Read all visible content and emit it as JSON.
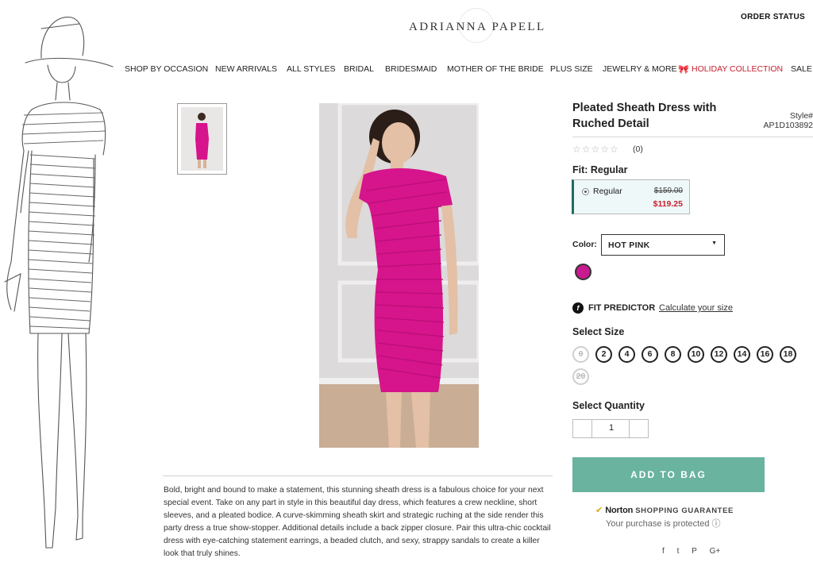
{
  "header": {
    "logo_text": "ADRIANNA PAPELL",
    "order_status": "ORDER STATUS",
    "order_status_cut": "S"
  },
  "nav": {
    "items": [
      "SHOP BY OCCASION",
      "NEW ARRIVALS",
      "ALL STYLES",
      "BRIDAL",
      "BRIDESMAID",
      "MOTHER OF THE BRIDE",
      "PLUS SIZE",
      "JEWELRY & MORE",
      "HOLIDAY COLLECTION",
      "SALE"
    ]
  },
  "product": {
    "title": "Pleated Sheath Dress with Ruched Detail",
    "style_label": "Style#",
    "style_number": "AP1D103892",
    "rating_stars": "☆☆☆☆☆",
    "rating_count": "(0)",
    "fit_label": "Fit: Regular",
    "fit_option": "Regular",
    "original_price": "$159.00",
    "sale_price": "$119.25",
    "color_label": "Color:",
    "color_value": "HOT PINK",
    "swatch_color": "#c81a8e",
    "fit_predictor": "FIT PREDICTOR",
    "fit_predictor_link": "Calculate your size",
    "size_label": "Select Size",
    "sizes": [
      "0",
      "2",
      "4",
      "6",
      "8",
      "10",
      "12",
      "14",
      "16",
      "18",
      "20"
    ],
    "quantity_label": "Select Quantity",
    "quantity_value": "1",
    "add_to_bag": "ADD TO BAG",
    "description": "Bold, bright and bound to make a statement, this stunning sheath dress is a fabulous choice for your next special event. Take on any part in style in this beautiful day dress, which features a crew neckline, short sleeves, and a pleated bodice. A curve-skimming sheath skirt and strategic ruching at the side render this party dress a true show-stopper. Additional details include a back zipper closure. Pair this ultra-chic cocktail dress with eye-catching statement earrings, a beaded clutch, and sexy, strappy sandals to create a killer look that truly shines."
  },
  "guarantee": {
    "brand": "Norton",
    "text": "SHOPPING GUARANTEE",
    "protected": "Your purchase is protected"
  },
  "social": {
    "facebook": "f",
    "twitter": "t",
    "pinterest": "P",
    "googleplus": "G+"
  },
  "colors": {
    "accent_teal": "#69b39f",
    "sale_red": "#c8202f",
    "dress_pink": "#d6148c"
  }
}
